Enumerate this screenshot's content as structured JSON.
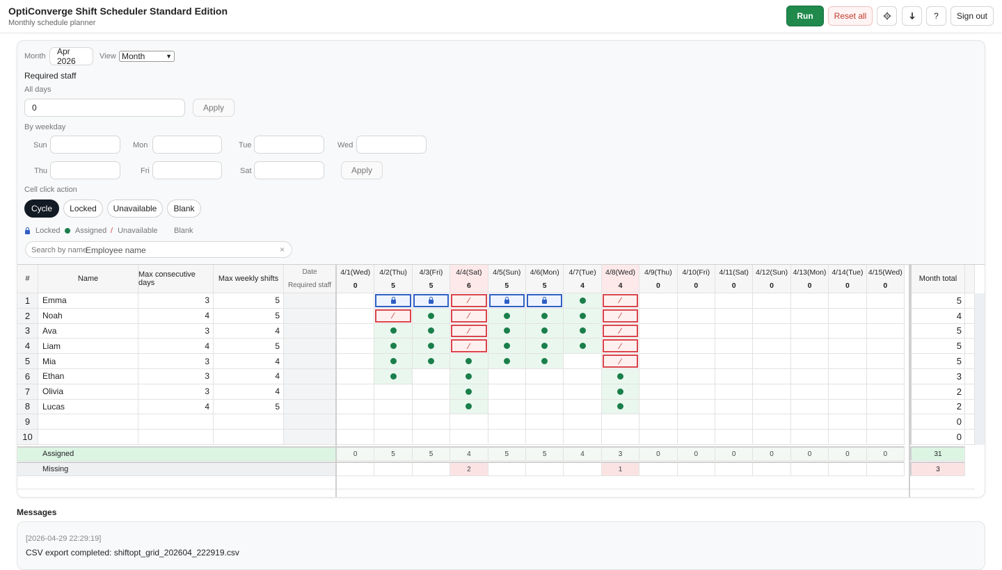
{
  "header": {
    "title": "OptiConverge Shift Scheduler Standard Edition",
    "subtitle": "Monthly schedule planner",
    "run_label": "Run",
    "reset_label": "Reset all",
    "settings_icon": "gear-icon",
    "download_icon": "download-icon",
    "help_label": "?",
    "signout_label": "Sign out"
  },
  "controls": {
    "month_label": "Month",
    "month_value": "Apr 2026",
    "view_label": "View",
    "view_value": "Month",
    "required_staff_title": "Required staff",
    "all_days_label": "All days",
    "all_days_value": "0",
    "apply_label": "Apply",
    "by_weekday_label": "By weekday",
    "weekdays": [
      "Sun",
      "Mon",
      "Tue",
      "Wed",
      "Thu",
      "Fri",
      "Sat"
    ],
    "cell_click_label": "Cell click action",
    "actions": [
      "Cycle",
      "Locked",
      "Unavailable",
      "Blank"
    ],
    "active_action": "Cycle",
    "legend": {
      "locked": "Locked",
      "assigned": "Assigned",
      "unavailable": "Unavailable",
      "blank": "Blank"
    },
    "search_label": "Search by name",
    "search_placeholder": "Employee name",
    "search_clear": "×"
  },
  "grid": {
    "col_index": "#",
    "col_name": "Name",
    "col_max_consecutive": "Max consecutive days",
    "col_max_weekly": "Max weekly shifts",
    "col_date": "Date",
    "col_required": "Required staff",
    "col_month_total": "Month total",
    "days": [
      {
        "label": "4/1(Wed)",
        "required": "0",
        "weekend": false,
        "assigned": "0",
        "missing": ""
      },
      {
        "label": "4/2(Thu)",
        "required": "5",
        "weekend": false,
        "assigned": "5",
        "missing": ""
      },
      {
        "label": "4/3(Fri)",
        "required": "5",
        "weekend": false,
        "assigned": "5",
        "missing": ""
      },
      {
        "label": "4/4(Sat)",
        "required": "6",
        "weekend": true,
        "assigned": "4",
        "missing": "2"
      },
      {
        "label": "4/5(Sun)",
        "required": "5",
        "weekend": false,
        "assigned": "5",
        "missing": ""
      },
      {
        "label": "4/6(Mon)",
        "required": "5",
        "weekend": false,
        "assigned": "5",
        "missing": ""
      },
      {
        "label": "4/7(Tue)",
        "required": "4",
        "weekend": false,
        "assigned": "4",
        "missing": ""
      },
      {
        "label": "4/8(Wed)",
        "required": "4",
        "weekend": true,
        "assigned": "3",
        "missing": "1"
      },
      {
        "label": "4/9(Thu)",
        "required": "0",
        "weekend": false,
        "assigned": "0",
        "missing": ""
      },
      {
        "label": "4/10(Fri)",
        "required": "0",
        "weekend": false,
        "assigned": "0",
        "missing": ""
      },
      {
        "label": "4/11(Sat)",
        "required": "0",
        "weekend": false,
        "assigned": "0",
        "missing": ""
      },
      {
        "label": "4/12(Sun)",
        "required": "0",
        "weekend": false,
        "assigned": "0",
        "missing": ""
      },
      {
        "label": "4/13(Mon)",
        "required": "0",
        "weekend": false,
        "assigned": "0",
        "missing": ""
      },
      {
        "label": "4/14(Tue)",
        "required": "0",
        "weekend": false,
        "assigned": "0",
        "missing": ""
      },
      {
        "label": "4/15(Wed)",
        "required": "0",
        "weekend": false,
        "assigned": "0",
        "missing": ""
      }
    ],
    "employees": [
      {
        "index": "1",
        "name": "Emma",
        "max_consecutive": "3",
        "max_weekly": "5",
        "total": "5",
        "cells": [
          "",
          "L",
          "L",
          "U",
          "L",
          "L",
          "A",
          "U"
        ]
      },
      {
        "index": "2",
        "name": "Noah",
        "max_consecutive": "4",
        "max_weekly": "5",
        "total": "4",
        "cells": [
          "",
          "U",
          "A",
          "U",
          "A",
          "A",
          "A",
          "U"
        ]
      },
      {
        "index": "3",
        "name": "Ava",
        "max_consecutive": "3",
        "max_weekly": "4",
        "total": "5",
        "cells": [
          "",
          "A",
          "A",
          "U",
          "A",
          "A",
          "A",
          "U"
        ]
      },
      {
        "index": "4",
        "name": "Liam",
        "max_consecutive": "4",
        "max_weekly": "5",
        "total": "5",
        "cells": [
          "",
          "A",
          "A",
          "U",
          "A",
          "A",
          "A",
          "U"
        ]
      },
      {
        "index": "5",
        "name": "Mia",
        "max_consecutive": "3",
        "max_weekly": "4",
        "total": "5",
        "cells": [
          "",
          "A",
          "A",
          "A",
          "A",
          "A",
          "",
          "U"
        ]
      },
      {
        "index": "6",
        "name": "Ethan",
        "max_consecutive": "3",
        "max_weekly": "4",
        "total": "3",
        "cells": [
          "",
          "A",
          "",
          "A",
          "",
          "",
          "",
          "A"
        ]
      },
      {
        "index": "7",
        "name": "Olivia",
        "max_consecutive": "3",
        "max_weekly": "4",
        "total": "2",
        "cells": [
          "",
          "",
          "",
          "A",
          "",
          "",
          "",
          "A"
        ]
      },
      {
        "index": "8",
        "name": "Lucas",
        "max_consecutive": "4",
        "max_weekly": "5",
        "total": "2",
        "cells": [
          "",
          "",
          "",
          "A",
          "",
          "",
          "",
          "A"
        ]
      },
      {
        "index": "9",
        "name": "",
        "max_consecutive": "",
        "max_weekly": "",
        "total": "0",
        "cells": []
      },
      {
        "index": "10",
        "name": "",
        "max_consecutive": "",
        "max_weekly": "",
        "total": "0",
        "cells": []
      }
    ],
    "assigned_label": "Assigned",
    "assigned_total": "31",
    "missing_label": "Missing",
    "missing_total": "3"
  },
  "messages": {
    "title": "Messages",
    "timestamp": "[2026-04-29 22:29:19]",
    "text": "CSV export completed: shiftopt_grid_202604_222919.csv"
  }
}
